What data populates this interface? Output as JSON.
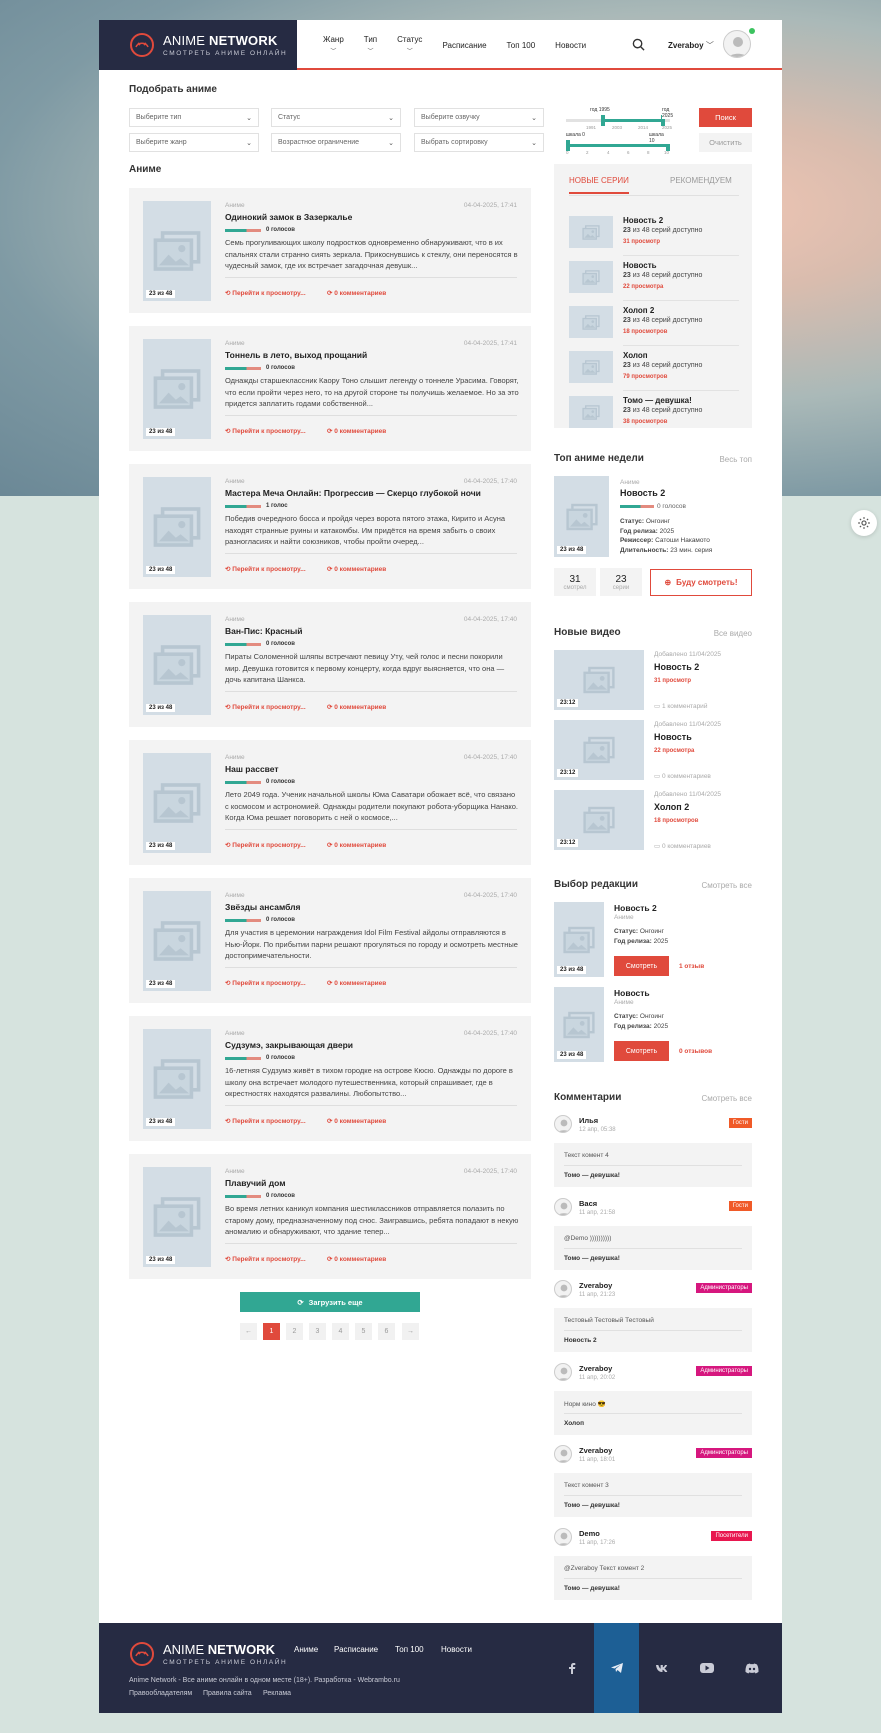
{
  "site": {
    "brand_light": "ANIME",
    "brand_bold": "NETWORK",
    "tagline": "СМОТРЕТЬ АНИМЕ ОНЛАЙН"
  },
  "nav": [
    {
      "label": "Жанр",
      "dropdown": true
    },
    {
      "label": "Тип",
      "dropdown": true
    },
    {
      "label": "Статус",
      "dropdown": true
    },
    {
      "label": "Расписание",
      "dropdown": false
    },
    {
      "label": "Топ 100",
      "dropdown": false
    },
    {
      "label": "Новости",
      "dropdown": false
    }
  ],
  "user": {
    "name": "Zveraboy"
  },
  "filter": {
    "title": "Подобрать аниме",
    "selects": [
      "Выберите тип",
      "Статус",
      "Выберите озвучку",
      "Выберите жанр",
      "Возрастное ограничение",
      "Выбрать сортировку"
    ],
    "year_slider": {
      "min_label": "год 1995",
      "max_label": "год 2025",
      "ticks": [
        "1991",
        "2003",
        "2014",
        "2025"
      ]
    },
    "score_slider": {
      "min_label": "шкала 0",
      "max_label": "шкала 10",
      "ticks": [
        "0",
        "2",
        "4",
        "6",
        "8",
        "10"
      ]
    },
    "search_label": "Поиск",
    "clear_label": "Очистить"
  },
  "anime_section_title": "Аниме",
  "cards": [
    {
      "category": "Аниме",
      "date": "04-04-2025, 17:41",
      "title": "Одинокий замок в Зазеркалье",
      "votes": "0 голосов",
      "episodes": "23 из 48",
      "desc": "Семь прогуливающих школу подростков одновременно обнаруживают, что в их спальнях стали странно сиять зеркала. Прикоснувшись к стеклу, они переносятся в чудесный замок, где их встречает загадочная девушк...",
      "watch": "Перейти к просмотру...",
      "comments": "0 комментариев"
    },
    {
      "category": "Аниме",
      "date": "04-04-2025, 17:41",
      "title": "Тоннель в лето, выход прощаний",
      "votes": "0 голосов",
      "episodes": "23 из 48",
      "desc": "Однажды старшеклассник Каору Тоно слышит легенду о тоннеле Урасима. Говорят, что если пройти через него, то на другой стороне ты получишь желаемое. Но за это придется заплатить годами собственной...",
      "watch": "Перейти к просмотру...",
      "comments": "0 комментариев"
    },
    {
      "category": "Аниме",
      "date": "04-04-2025, 17:40",
      "title": "Мастера Меча Онлайн: Прогрессив — Скерцо глубокой ночи",
      "votes": "1 голос",
      "episodes": "23 из 48",
      "desc": "Победив очередного босса и пройдя через ворота пятого этажа, Кирито и Асуна находят странные руины и катакомбы. Им придётся на время забыть о своих разногласиях и найти союзников, чтобы пройти очеред...",
      "watch": "Перейти к просмотру...",
      "comments": "0 комментариев"
    },
    {
      "category": "Аниме",
      "date": "04-04-2025, 17:40",
      "title": "Ван-Пис: Красный",
      "votes": "0 голосов",
      "episodes": "23 из 48",
      "desc": "Пираты Соломенной шляпы встречают певицу Уту, чей голос и песни покорили мир. Девушка готовится к первому концерту, когда вдруг выясняется, что она — дочь капитана Шанкса.",
      "watch": "Перейти к просмотру...",
      "comments": "0 комментариев"
    },
    {
      "category": "Аниме",
      "date": "04-04-2025, 17:40",
      "title": "Наш рассвет",
      "votes": "0 голосов",
      "episodes": "23 из 48",
      "desc": "Лето 2049 года. Ученик начальной школы Юма Саватари обожает всё, что связано с космосом и астрономией. Однажды родители покупают робота-уборщика Нанако. Когда Юма решает поговорить с ней о космосе,...",
      "watch": "Перейти к просмотру...",
      "comments": "0 комментариев"
    },
    {
      "category": "Аниме",
      "date": "04-04-2025, 17:40",
      "title": "Звёзды ансамбля",
      "votes": "0 голосов",
      "episodes": "23 из 48",
      "desc": "Для участия в церемонии награждения Idol Film Festival айдолы отправляются в Нью-Йорк. По прибытии парни решают прогуляться по городу и осмотреть местные достопримечательности.",
      "watch": "Перейти к просмотру...",
      "comments": "0 комментариев"
    },
    {
      "category": "Аниме",
      "date": "04-04-2025, 17:40",
      "title": "Судзумэ, закрывающая двери",
      "votes": "0 голосов",
      "episodes": "23 из 48",
      "desc": "16-летняя Судзумэ живёт в тихом городке на острове Кюсю. Однажды по дороге в школу она встречает молодого путешественника, который спрашивает, где в окрестностях находятся развалины. Любопытство...",
      "watch": "Перейти к просмотру...",
      "comments": "0 комментариев"
    },
    {
      "category": "Аниме",
      "date": "04-04-2025, 17:40",
      "title": "Плавучий дом",
      "votes": "0 голосов",
      "episodes": "23 из 48",
      "desc": "Во время летних каникул компания шестиклассников отправляется полазить по старому дому, предназначенному под снос. Заигравшись, ребята попадают в некую аномалию и обнаруживают, что здание тепер...",
      "watch": "Перейти к просмотру...",
      "comments": "0 комментариев"
    }
  ],
  "load_more": "Загрузить еще",
  "pagination": [
    "1",
    "2",
    "3",
    "4",
    "5",
    "6"
  ],
  "tabs": {
    "active": "НОВЫЕ СЕРИИ",
    "other": "РЕКОМЕНДУЕМ"
  },
  "new_series": [
    {
      "title": "Новость 2",
      "count": "23",
      "count_rest": "из 48 серий доступно",
      "views": "31 просмотр"
    },
    {
      "title": "Новость",
      "count": "23",
      "count_rest": "из 48 серий доступно",
      "views": "22 просмотра"
    },
    {
      "title": "Холоп 2",
      "count": "23",
      "count_rest": "из 48 серий доступно",
      "views": "18 просмотров"
    },
    {
      "title": "Холоп",
      "count": "23",
      "count_rest": "из 48 серий доступно",
      "views": "79 просмотров"
    },
    {
      "title": "Томо — девушка!",
      "count": "23",
      "count_rest": "из 48 серий доступно",
      "views": "38 просмотров"
    }
  ],
  "top_week": {
    "title": "Топ аниме недели",
    "all": "Весь топ",
    "category": "Аниме",
    "name": "Новость 2",
    "votes": "0 голосов",
    "episodes": "23 из 48",
    "status_label": "Статус:",
    "status": "Онгоинг",
    "year_label": "Год релиза:",
    "year": "2025",
    "director_label": "Режиссер:",
    "director": "Сатоши Накамото",
    "duration_label": "Длительность:",
    "duration": "23 мин. серия",
    "watched_n": "31",
    "watched_l": "смотрел",
    "series_n": "23",
    "series_l": "серии",
    "will_watch": "Буду смотреть!"
  },
  "videos": {
    "title": "Новые видео",
    "all": "Все видео",
    "items": [
      {
        "added": "Добавлено 11/04/2025",
        "title": "Новость 2",
        "views": "31 просмотр",
        "comments": "1 комментарий",
        "duration": "23:12"
      },
      {
        "added": "Добавлено 11/04/2025",
        "title": "Новость",
        "views": "22 просмотра",
        "comments": "0 комментариев",
        "duration": "23:12"
      },
      {
        "added": "Добавлено 11/04/2025",
        "title": "Холоп 2",
        "views": "18 просмотров",
        "comments": "0 комментариев",
        "duration": "23:12"
      }
    ]
  },
  "editors": {
    "title": "Выбор редакции",
    "all": "Смотреть все",
    "items": [
      {
        "title": "Новость 2",
        "category": "Аниме",
        "status_label": "Статус:",
        "status": "Онгоинг",
        "year_label": "Год релиза:",
        "year": "2025",
        "button": "Смотреть",
        "reviews": "1 отзыв",
        "episodes": "23 из 48"
      },
      {
        "title": "Новость",
        "category": "Аниме",
        "status_label": "Статус:",
        "status": "Онгоинг",
        "year_label": "Год релиза:",
        "year": "2025",
        "button": "Смотреть",
        "reviews": "0 отзывов",
        "episodes": "23 из 48"
      }
    ]
  },
  "comments": {
    "title": "Комментарии",
    "all": "Смотреть все",
    "items": [
      {
        "user": "Илья",
        "date": "12 апр, 05:38",
        "badge": "Гости",
        "badge_color": "#f05a28",
        "text": "Текст комент 4",
        "anime": "Томо — девушка!"
      },
      {
        "user": "Вася",
        "date": "11 апр, 21:58",
        "badge": "Гости",
        "badge_color": "#f05a28",
        "text": "@Demo  ))))))))))",
        "anime": "Томо — девушка!"
      },
      {
        "user": "Zveraboy",
        "date": "11 апр, 21:23",
        "badge": "Администраторы",
        "badge_color": "#d6177e",
        "text": "Тестовый Тестовый Тестовый",
        "anime": "Новость 2"
      },
      {
        "user": "Zveraboy",
        "date": "11 апр, 20:02",
        "badge": "Администраторы",
        "badge_color": "#d6177e",
        "text": "Норм кино  😎",
        "anime": "Холоп"
      },
      {
        "user": "Zveraboy",
        "date": "11 апр, 18:01",
        "badge": "Администраторы",
        "badge_color": "#d6177e",
        "text": "Текст комент 3",
        "anime": "Томо — девушка!"
      },
      {
        "user": "Demo",
        "date": "11 апр, 17:26",
        "badge": "Посетители",
        "badge_color": "#e8174f",
        "text": "@Zveraboy  Текст  комент 2",
        "anime": "Томо — девушка!"
      }
    ]
  },
  "footer": {
    "nav": [
      "Аниме",
      "Расписание",
      "Топ 100",
      "Новости"
    ],
    "copy": "Anime Network - Все аниме онлайн в одном месте (18+). Разработка - Webrambo.ru",
    "links": [
      "Правообладателям",
      "Правила сайта",
      "Реклама"
    ],
    "social": [
      "facebook-icon",
      "telegram-icon",
      "vk-icon",
      "youtube-icon",
      "discord-icon"
    ]
  },
  "colors": {
    "accent": "#e04a3c",
    "teal": "#31a793",
    "dark": "#262b43",
    "telegram": "#1d5f95"
  }
}
